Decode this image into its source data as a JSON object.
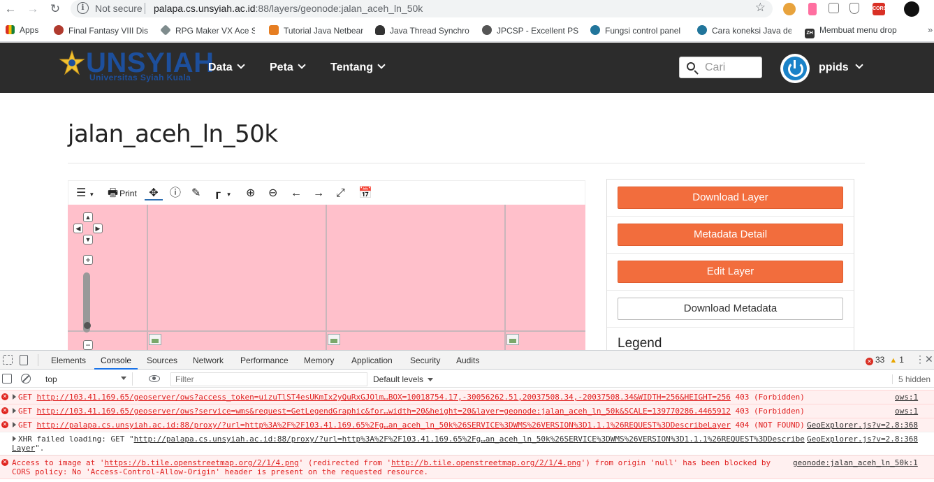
{
  "browser": {
    "security_label": "Not secure",
    "url_host": "palapa.cs.unsyiah.ac.id",
    "url_rest": ":88/layers/geonode:jalan_aceh_ln_50k",
    "ext_cors": "CORS",
    "ext_zh": "ZH"
  },
  "bookmarks": [
    {
      "label": "Apps",
      "color": "#c0392b"
    },
    {
      "label": "Final Fantasy VIII Disc",
      "color": "#b03a2e"
    },
    {
      "label": "RPG Maker VX Ace S",
      "color": "#7f8c8d"
    },
    {
      "label": "Tutorial Java Netbean",
      "color": "#e67e22"
    },
    {
      "label": "Java Thread Synchron",
      "color": "#333333"
    },
    {
      "label": "JPCSP - Excellent PSP",
      "color": "#555555"
    },
    {
      "label": "Fungsi control panel",
      "color": "#21759b"
    },
    {
      "label": "Cara koneksi Java de",
      "color": "#21759b"
    },
    {
      "label": "Membuat menu drop",
      "color": "#333333"
    }
  ],
  "site": {
    "logo_title": "UNSYIAH",
    "logo_subtitle": "Universitas Syiah Kuala",
    "nav": [
      {
        "label": "Data"
      },
      {
        "label": "Peta"
      },
      {
        "label": "Tentang"
      }
    ],
    "search_placeholder": "Cari",
    "user_name": "ppids",
    "brand_color": "#1d4f9c"
  },
  "page": {
    "title": "jalan_aceh_ln_50k"
  },
  "map_toolbar": {
    "print_label": "Print"
  },
  "side_panel": {
    "buttons": [
      {
        "label": "Download Layer",
        "style": "orange"
      },
      {
        "label": "Metadata Detail",
        "style": "orange"
      },
      {
        "label": "Edit Layer",
        "style": "orange"
      },
      {
        "label": "Download Metadata",
        "style": "white"
      }
    ],
    "legend_title": "Legend",
    "accent_color": "#f26d3d"
  },
  "devtools": {
    "tabs": [
      "Elements",
      "Console",
      "Sources",
      "Network",
      "Performance",
      "Memory",
      "Application",
      "Security",
      "Audits"
    ],
    "active_tab": "Console",
    "error_count": "33",
    "warning_count": "1",
    "context": "top",
    "filter_placeholder": "Filter",
    "levels_label": "Default levels",
    "hidden_label": "5 hidden",
    "messages": [
      {
        "level": "error",
        "method": "GET",
        "url": "http://103.41.169.65/geoserver/ows?access_token=uizuTlST4esUKmIx2yQuRxGJOlm…BOX=10018754.17,-30056262.51,20037508.34,-20037508.34&WIDTH=256&HEIGHT=256",
        "status": "403 (Forbidden)",
        "source": "ows:1"
      },
      {
        "level": "error",
        "method": "GET",
        "url": "http://103.41.169.65/geoserver/ows?service=wms&request=GetLegendGraphic&for…width=20&height=20&layer=geonode:jalan_aceh_ln_50k&SCALE=139770286.4465912",
        "status": "403 (Forbidden)",
        "source": "ows:1"
      },
      {
        "level": "error",
        "method": "GET",
        "url": "http://palapa.cs.unsyiah.ac.id:88/proxy/?url=http%3A%2F%2F103.41.169.65%2Fg…an_aceh_ln_50k%26SERVICE%3DWMS%26VERSION%3D1.1.1%26REQUEST%3DDescribeLayer",
        "status": "404 (NOT FOUND)",
        "source": "GeoExplorer.js?v=2.8:368"
      },
      {
        "level": "info",
        "prefix": "XHR failed loading: GET \"",
        "url": "http://palapa.cs.unsyiah.ac.id:88/proxy/?url=http%3A%2F%2F103.41.169.65%2Fg…an_aceh_ln_50k%26SERVICE%3DWMS%26VERSION%3D1.1.1%26REQUEST%3DDescribe",
        "cont": "Layer",
        "suffix": "\".",
        "source": "GeoExplorer.js?v=2.8:368"
      },
      {
        "level": "error",
        "part1": "Access to image at '",
        "url1": "https://b.tile.openstreetmap.org/2/1/4.png",
        "part2": "' (redirected from '",
        "url2": "http://b.tile.openstreetmap.org/2/1/4.png",
        "part3": "') from origin 'null' has been blocked by",
        "line2": "CORS policy: No 'Access-Control-Allow-Origin' header is present on the requested resource.",
        "source": "geonode:jalan_aceh_ln_50k:1"
      }
    ]
  }
}
